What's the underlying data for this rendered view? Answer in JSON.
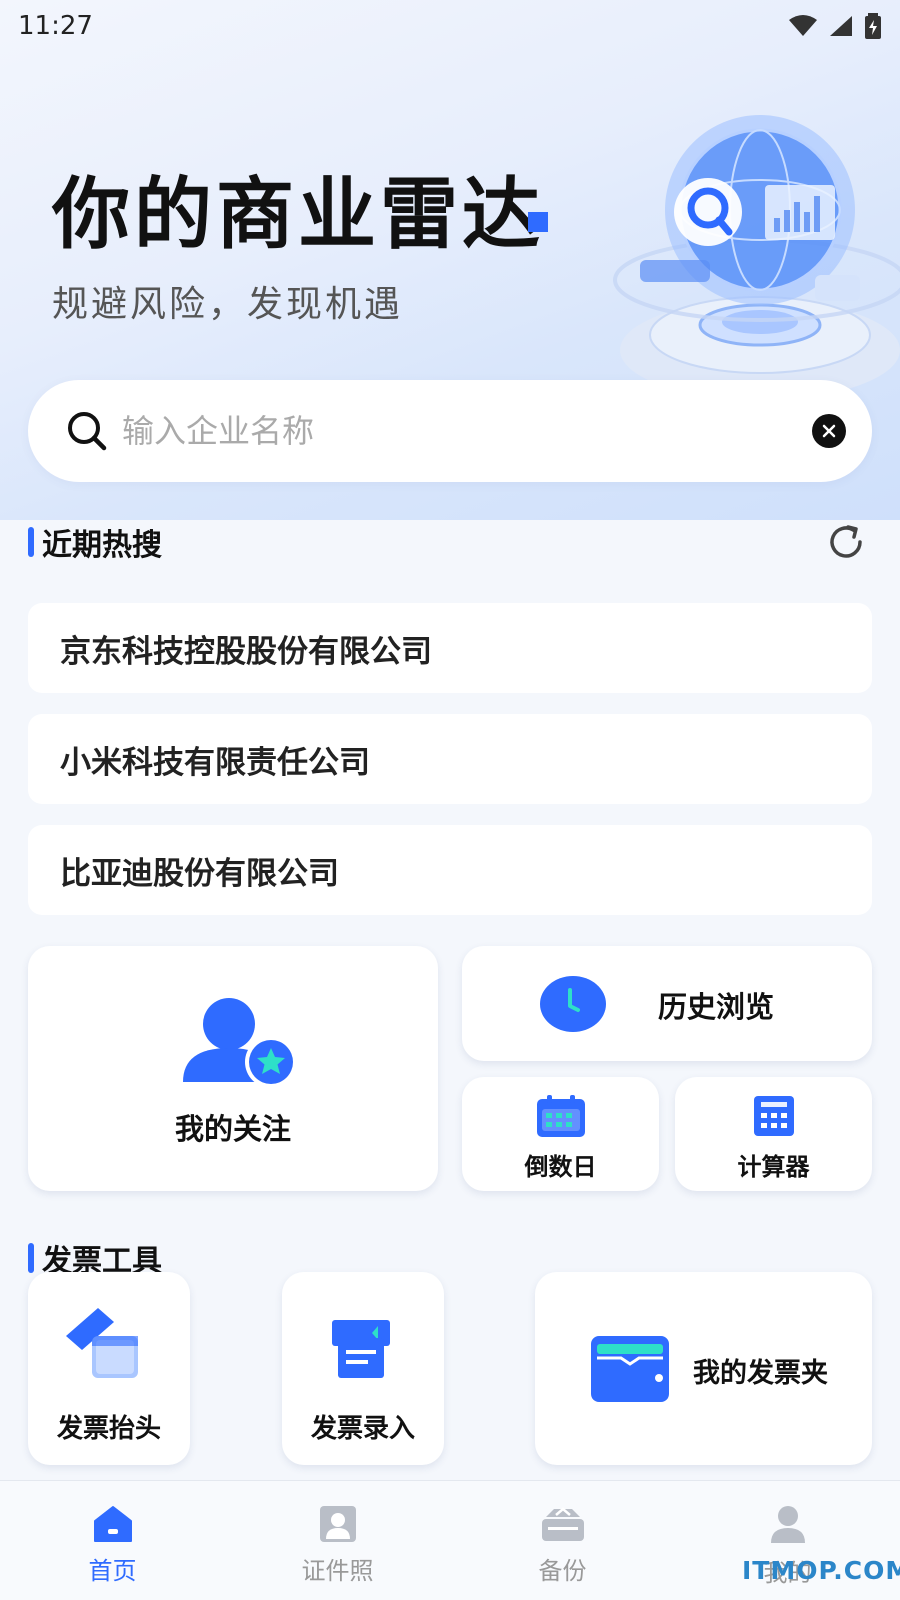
{
  "status": {
    "time": "11:27"
  },
  "hero": {
    "title": "你的商业雷达",
    "subtitle": "规避风险，发现机遇"
  },
  "search": {
    "placeholder": "输入企业名称"
  },
  "recent": {
    "title": "近期热搜",
    "items": [
      "京东科技控股股份有限公司",
      "小米科技有限责任公司",
      "比亚迪股份有限公司"
    ]
  },
  "tools": {
    "follow": "我的关注",
    "history": "历史浏览",
    "countdown": "倒数日",
    "calculator": "计算器"
  },
  "invoice": {
    "title": "发票工具",
    "header": "发票抬头",
    "entry": "发票录入",
    "folder": "我的发票夹"
  },
  "tabs": [
    "首页",
    "证件照",
    "备份",
    "我的"
  ],
  "watermark": "ITMOP.COM",
  "colors": {
    "accent": "#2f6bff",
    "active_tab": "#2f6bff",
    "inactive_tab": "#999999"
  }
}
